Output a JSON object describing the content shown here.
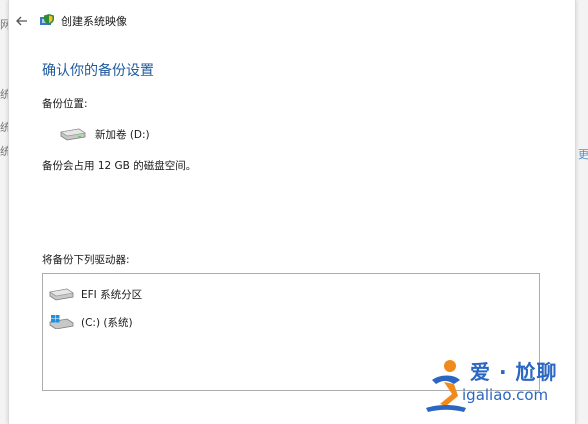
{
  "background": {
    "fragments_left": [
      "网",
      "统",
      "统",
      "统"
    ],
    "fragment_right": "更"
  },
  "window": {
    "title": "创建系统映像",
    "back_icon": "back-arrow-icon",
    "app_icon": "backup-shield-icon"
  },
  "main": {
    "heading": "确认你的备份设置",
    "backup_location_label": "备份位置:",
    "backup_location_drive": "新加卷 (D:)",
    "space_note": "备份会占用 12 GB 的磁盘空间。",
    "drives_label": "将备份下列驱动器:",
    "drives": [
      {
        "label": "EFI 系统分区",
        "icon": "drive-icon"
      },
      {
        "label": "(C:) (系统)",
        "icon": "windows-drive-icon"
      }
    ]
  },
  "watermark": {
    "top": "爱 · 尬聊",
    "bottom": "igaliao.com"
  },
  "colors": {
    "heading": "#1f5a9e",
    "watermark": "#2a66c2",
    "watermark_accent": "#f08a1c"
  }
}
